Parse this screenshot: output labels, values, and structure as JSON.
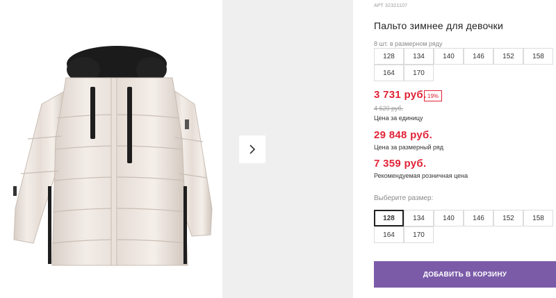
{
  "product": {
    "article": "АРТ 32321107",
    "title": "Пальто зимнее для девочки",
    "pack_hint": "8 шт. в размерном ряду",
    "pack_sizes": [
      "128",
      "134",
      "140",
      "146",
      "152",
      "158",
      "164",
      "170"
    ],
    "price_unit": "3 731 руб.",
    "discount": "19%",
    "price_old": "4 620 руб.",
    "price_unit_caption": "Цена за единицу",
    "price_pack": "29 848 руб.",
    "price_pack_caption": "Цена за размерный ряд",
    "price_retail": "7 359 руб.",
    "price_retail_caption": "Рекомендуемая розничная цена",
    "size_select_hint": "Выберите размер:",
    "sizes": [
      "128",
      "134",
      "140",
      "146",
      "152",
      "158",
      "164",
      "170"
    ],
    "selected_size": "128",
    "cart_button": "ДОБАВИТЬ В КОРЗИНУ"
  },
  "colors": {
    "price_red": "#e02236",
    "cart_purple": "#7b5ba8",
    "gallery_gray": "#efefef"
  },
  "icons": {
    "next": "chevron-right-icon"
  }
}
